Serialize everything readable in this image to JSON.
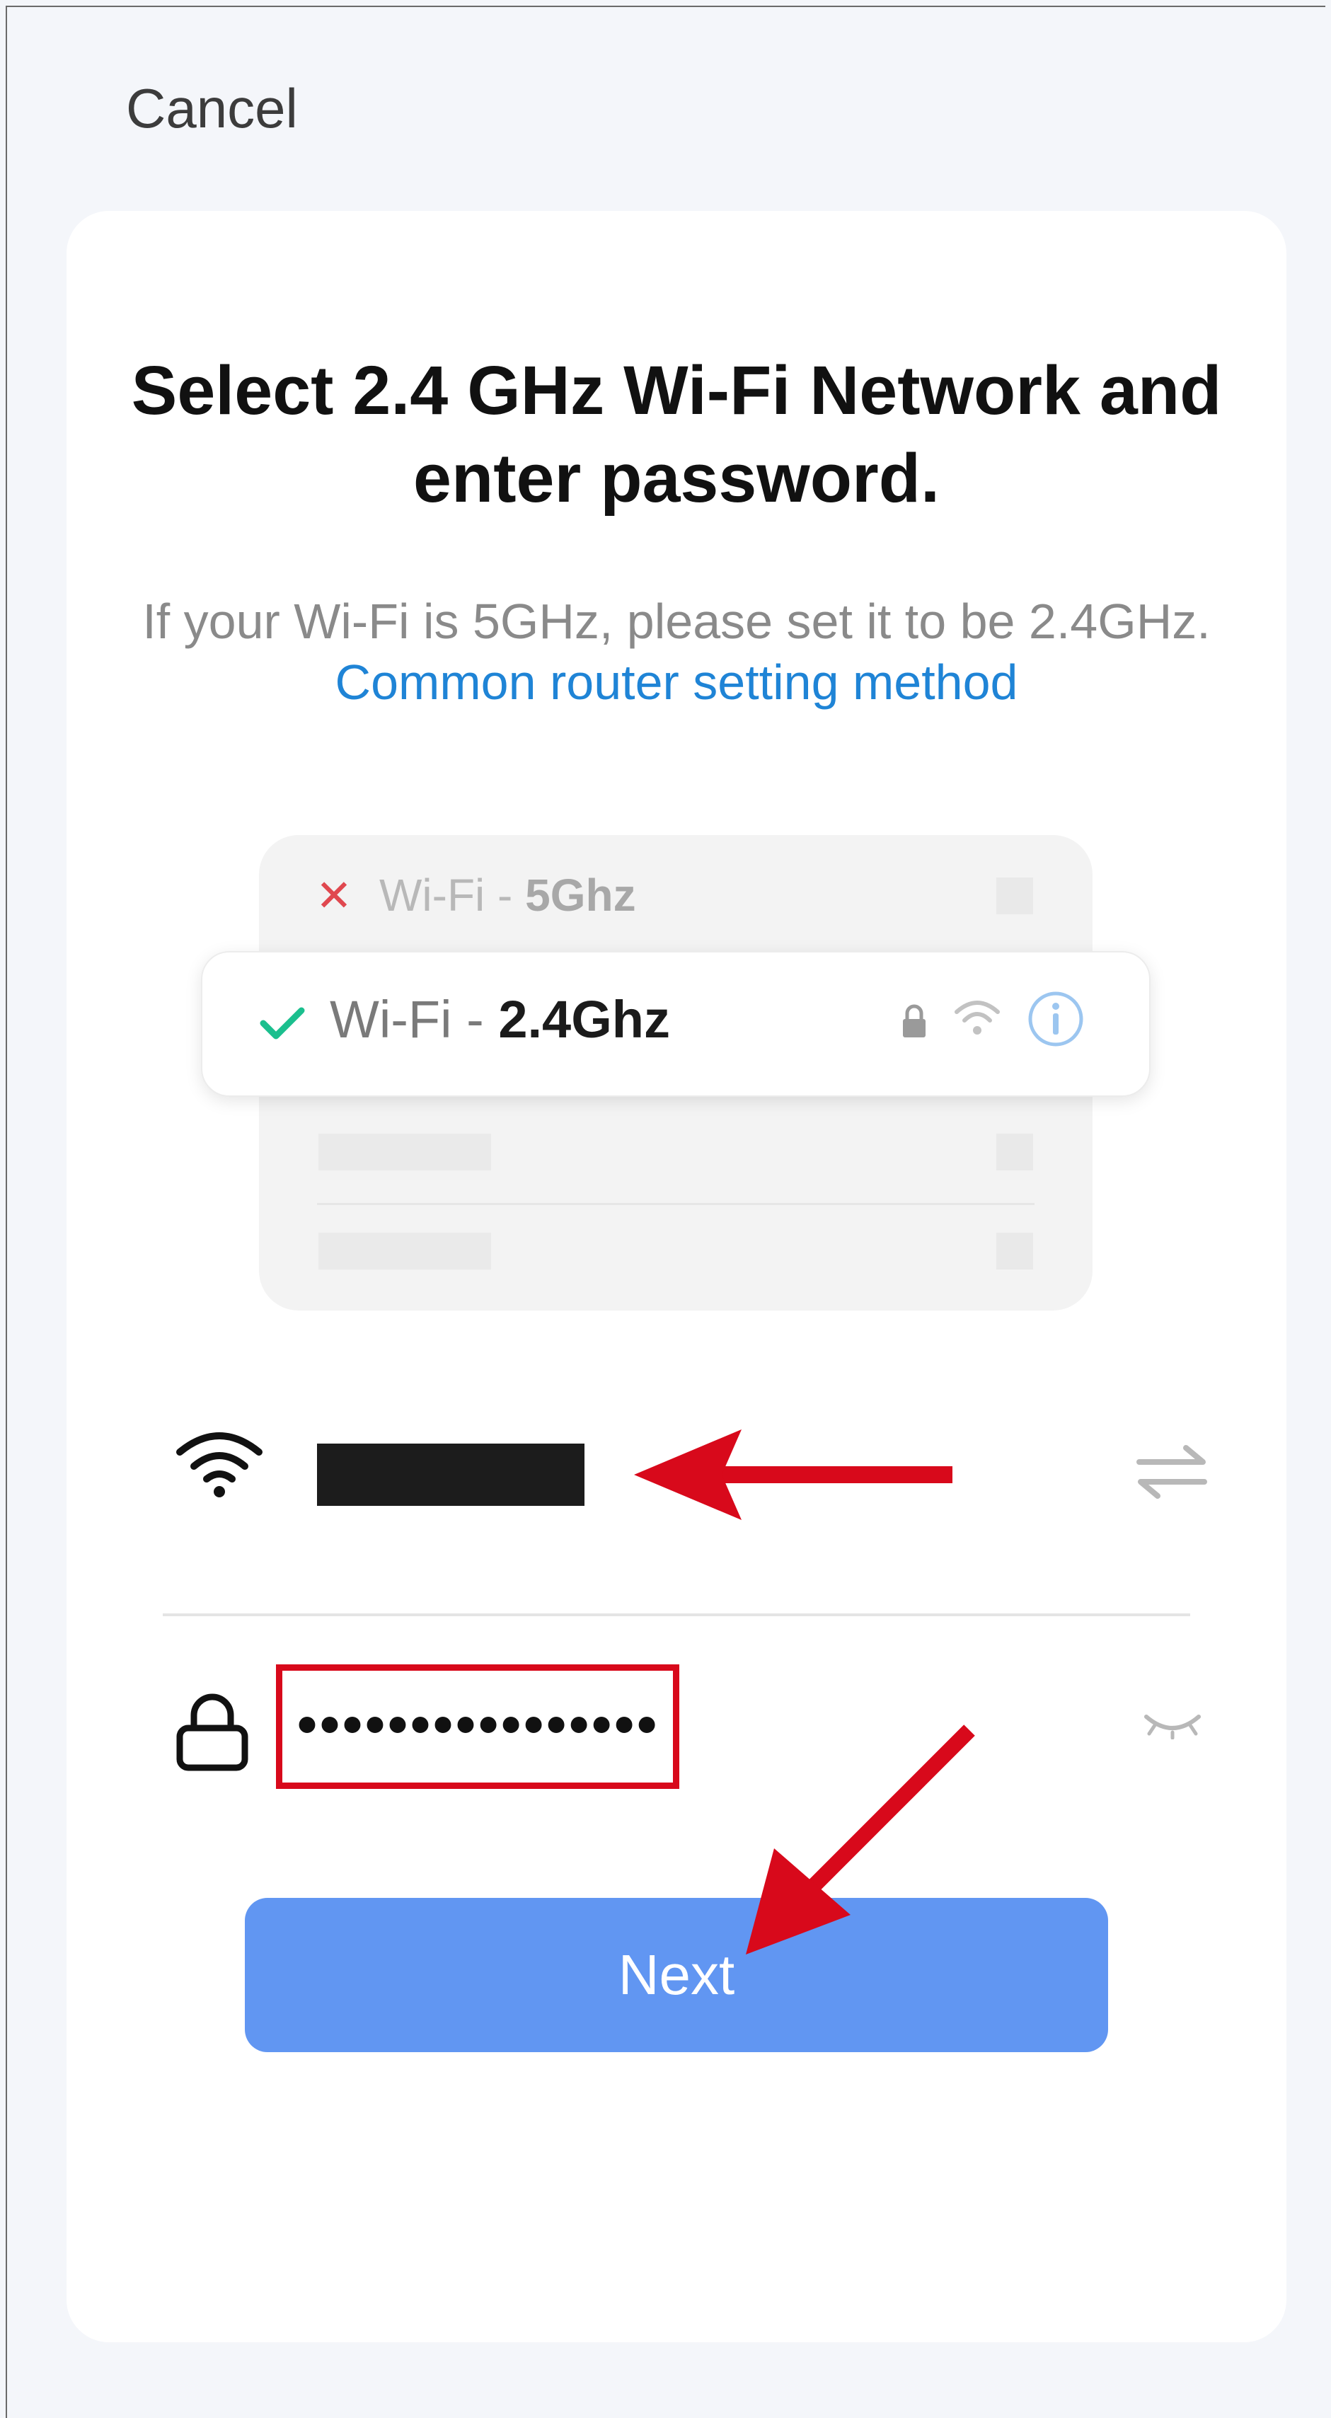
{
  "header": {
    "cancel_label": "Cancel"
  },
  "title": "Select 2.4 GHz Wi-Fi Network and enter password.",
  "subtitle": {
    "text": "If your Wi-Fi is 5GHz, please set it to be 2.4GHz.",
    "link": "Common router setting method"
  },
  "illustration": {
    "row_5ghz": {
      "prefix": "Wi-Fi - ",
      "band": "5Ghz"
    },
    "row_24ghz": {
      "prefix": "Wi-Fi - ",
      "band": "2.4Ghz"
    }
  },
  "form": {
    "password_value": "••••••••••••••••"
  },
  "next_button": {
    "label": "Next"
  },
  "colors": {
    "accent": "#6196f2",
    "link": "#1f84d6",
    "annotation_red": "#d8091b",
    "check_green": "#1bbf8e",
    "cross_red": "#e0484f"
  },
  "icons": [
    "wifi-icon",
    "lock-icon",
    "swap-icon",
    "eye-closed-icon",
    "check-icon",
    "cross-icon",
    "info-icon"
  ]
}
